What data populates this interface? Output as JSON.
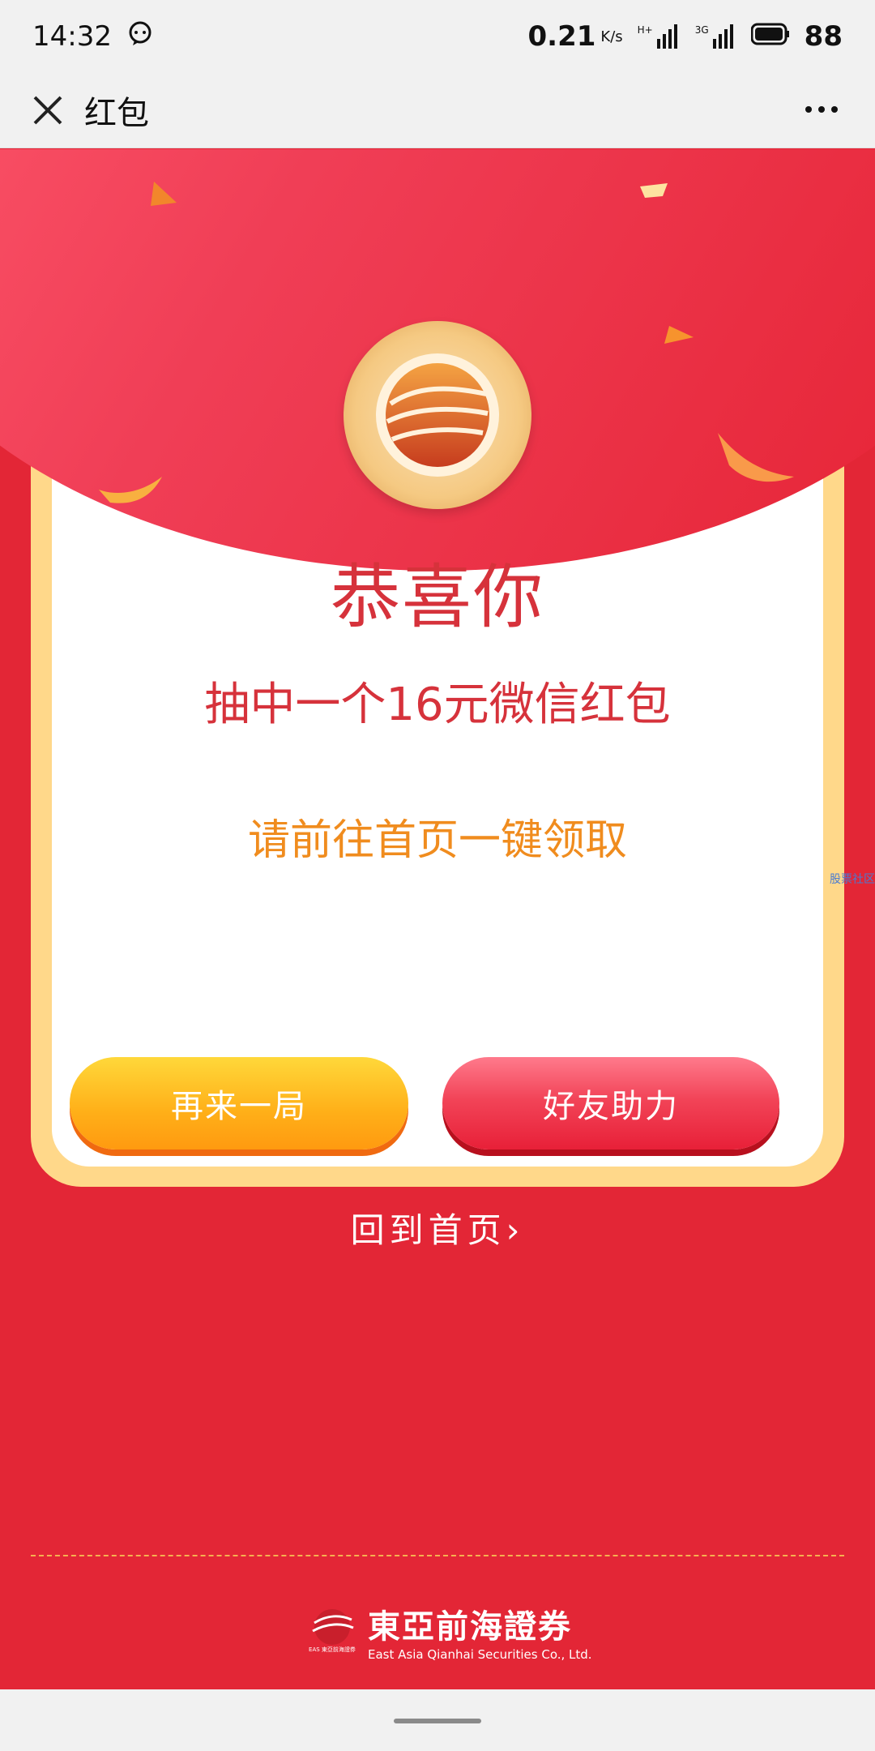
{
  "status_bar": {
    "time": "14:32",
    "network_speed": "0.21",
    "speed_unit": "K/s",
    "signal_1": "H+",
    "signal_2": "3G",
    "battery": "88"
  },
  "titlebar": {
    "title": "红包"
  },
  "result_card": {
    "headline": "恭喜你",
    "prize_text": "抽中一个16元微信红包",
    "hint_text": "请前往首页一键领取"
  },
  "side_link": "股票社区",
  "buttons": {
    "play_again": "再来一局",
    "friend_help": "好友助力"
  },
  "home_link": "回到首页",
  "footer": {
    "brand_name": "東亞前海證券",
    "brand_english": "East Asia Qianhai Securities Co., Ltd.",
    "logo_caption": "EAS 東亞前海證券"
  },
  "colors": {
    "page_red": "#e32636",
    "card_border": "#ffd88a",
    "headline_red": "#d6323b",
    "hint_orange": "#f08c1e"
  }
}
